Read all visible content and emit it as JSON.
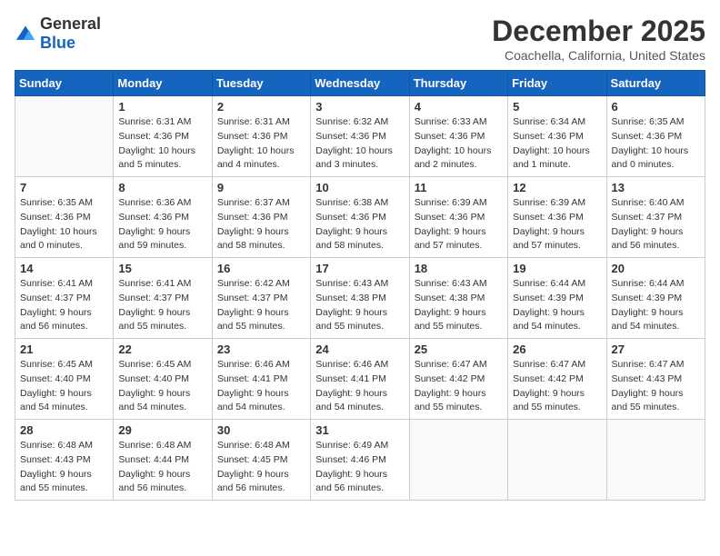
{
  "header": {
    "logo_general": "General",
    "logo_blue": "Blue",
    "title": "December 2025",
    "subtitle": "Coachella, California, United States"
  },
  "calendar": {
    "days_of_week": [
      "Sunday",
      "Monday",
      "Tuesday",
      "Wednesday",
      "Thursday",
      "Friday",
      "Saturday"
    ],
    "weeks": [
      [
        {
          "day": "",
          "info": ""
        },
        {
          "day": "1",
          "info": "Sunrise: 6:31 AM\nSunset: 4:36 PM\nDaylight: 10 hours\nand 5 minutes."
        },
        {
          "day": "2",
          "info": "Sunrise: 6:31 AM\nSunset: 4:36 PM\nDaylight: 10 hours\nand 4 minutes."
        },
        {
          "day": "3",
          "info": "Sunrise: 6:32 AM\nSunset: 4:36 PM\nDaylight: 10 hours\nand 3 minutes."
        },
        {
          "day": "4",
          "info": "Sunrise: 6:33 AM\nSunset: 4:36 PM\nDaylight: 10 hours\nand 2 minutes."
        },
        {
          "day": "5",
          "info": "Sunrise: 6:34 AM\nSunset: 4:36 PM\nDaylight: 10 hours\nand 1 minute."
        },
        {
          "day": "6",
          "info": "Sunrise: 6:35 AM\nSunset: 4:36 PM\nDaylight: 10 hours\nand 0 minutes."
        }
      ],
      [
        {
          "day": "7",
          "info": "Sunrise: 6:35 AM\nSunset: 4:36 PM\nDaylight: 10 hours\nand 0 minutes."
        },
        {
          "day": "8",
          "info": "Sunrise: 6:36 AM\nSunset: 4:36 PM\nDaylight: 9 hours\nand 59 minutes."
        },
        {
          "day": "9",
          "info": "Sunrise: 6:37 AM\nSunset: 4:36 PM\nDaylight: 9 hours\nand 58 minutes."
        },
        {
          "day": "10",
          "info": "Sunrise: 6:38 AM\nSunset: 4:36 PM\nDaylight: 9 hours\nand 58 minutes."
        },
        {
          "day": "11",
          "info": "Sunrise: 6:39 AM\nSunset: 4:36 PM\nDaylight: 9 hours\nand 57 minutes."
        },
        {
          "day": "12",
          "info": "Sunrise: 6:39 AM\nSunset: 4:36 PM\nDaylight: 9 hours\nand 57 minutes."
        },
        {
          "day": "13",
          "info": "Sunrise: 6:40 AM\nSunset: 4:37 PM\nDaylight: 9 hours\nand 56 minutes."
        }
      ],
      [
        {
          "day": "14",
          "info": "Sunrise: 6:41 AM\nSunset: 4:37 PM\nDaylight: 9 hours\nand 56 minutes."
        },
        {
          "day": "15",
          "info": "Sunrise: 6:41 AM\nSunset: 4:37 PM\nDaylight: 9 hours\nand 55 minutes."
        },
        {
          "day": "16",
          "info": "Sunrise: 6:42 AM\nSunset: 4:37 PM\nDaylight: 9 hours\nand 55 minutes."
        },
        {
          "day": "17",
          "info": "Sunrise: 6:43 AM\nSunset: 4:38 PM\nDaylight: 9 hours\nand 55 minutes."
        },
        {
          "day": "18",
          "info": "Sunrise: 6:43 AM\nSunset: 4:38 PM\nDaylight: 9 hours\nand 55 minutes."
        },
        {
          "day": "19",
          "info": "Sunrise: 6:44 AM\nSunset: 4:39 PM\nDaylight: 9 hours\nand 54 minutes."
        },
        {
          "day": "20",
          "info": "Sunrise: 6:44 AM\nSunset: 4:39 PM\nDaylight: 9 hours\nand 54 minutes."
        }
      ],
      [
        {
          "day": "21",
          "info": "Sunrise: 6:45 AM\nSunset: 4:40 PM\nDaylight: 9 hours\nand 54 minutes."
        },
        {
          "day": "22",
          "info": "Sunrise: 6:45 AM\nSunset: 4:40 PM\nDaylight: 9 hours\nand 54 minutes."
        },
        {
          "day": "23",
          "info": "Sunrise: 6:46 AM\nSunset: 4:41 PM\nDaylight: 9 hours\nand 54 minutes."
        },
        {
          "day": "24",
          "info": "Sunrise: 6:46 AM\nSunset: 4:41 PM\nDaylight: 9 hours\nand 54 minutes."
        },
        {
          "day": "25",
          "info": "Sunrise: 6:47 AM\nSunset: 4:42 PM\nDaylight: 9 hours\nand 55 minutes."
        },
        {
          "day": "26",
          "info": "Sunrise: 6:47 AM\nSunset: 4:42 PM\nDaylight: 9 hours\nand 55 minutes."
        },
        {
          "day": "27",
          "info": "Sunrise: 6:47 AM\nSunset: 4:43 PM\nDaylight: 9 hours\nand 55 minutes."
        }
      ],
      [
        {
          "day": "28",
          "info": "Sunrise: 6:48 AM\nSunset: 4:43 PM\nDaylight: 9 hours\nand 55 minutes."
        },
        {
          "day": "29",
          "info": "Sunrise: 6:48 AM\nSunset: 4:44 PM\nDaylight: 9 hours\nand 56 minutes."
        },
        {
          "day": "30",
          "info": "Sunrise: 6:48 AM\nSunset: 4:45 PM\nDaylight: 9 hours\nand 56 minutes."
        },
        {
          "day": "31",
          "info": "Sunrise: 6:49 AM\nSunset: 4:46 PM\nDaylight: 9 hours\nand 56 minutes."
        },
        {
          "day": "",
          "info": ""
        },
        {
          "day": "",
          "info": ""
        },
        {
          "day": "",
          "info": ""
        }
      ]
    ]
  }
}
